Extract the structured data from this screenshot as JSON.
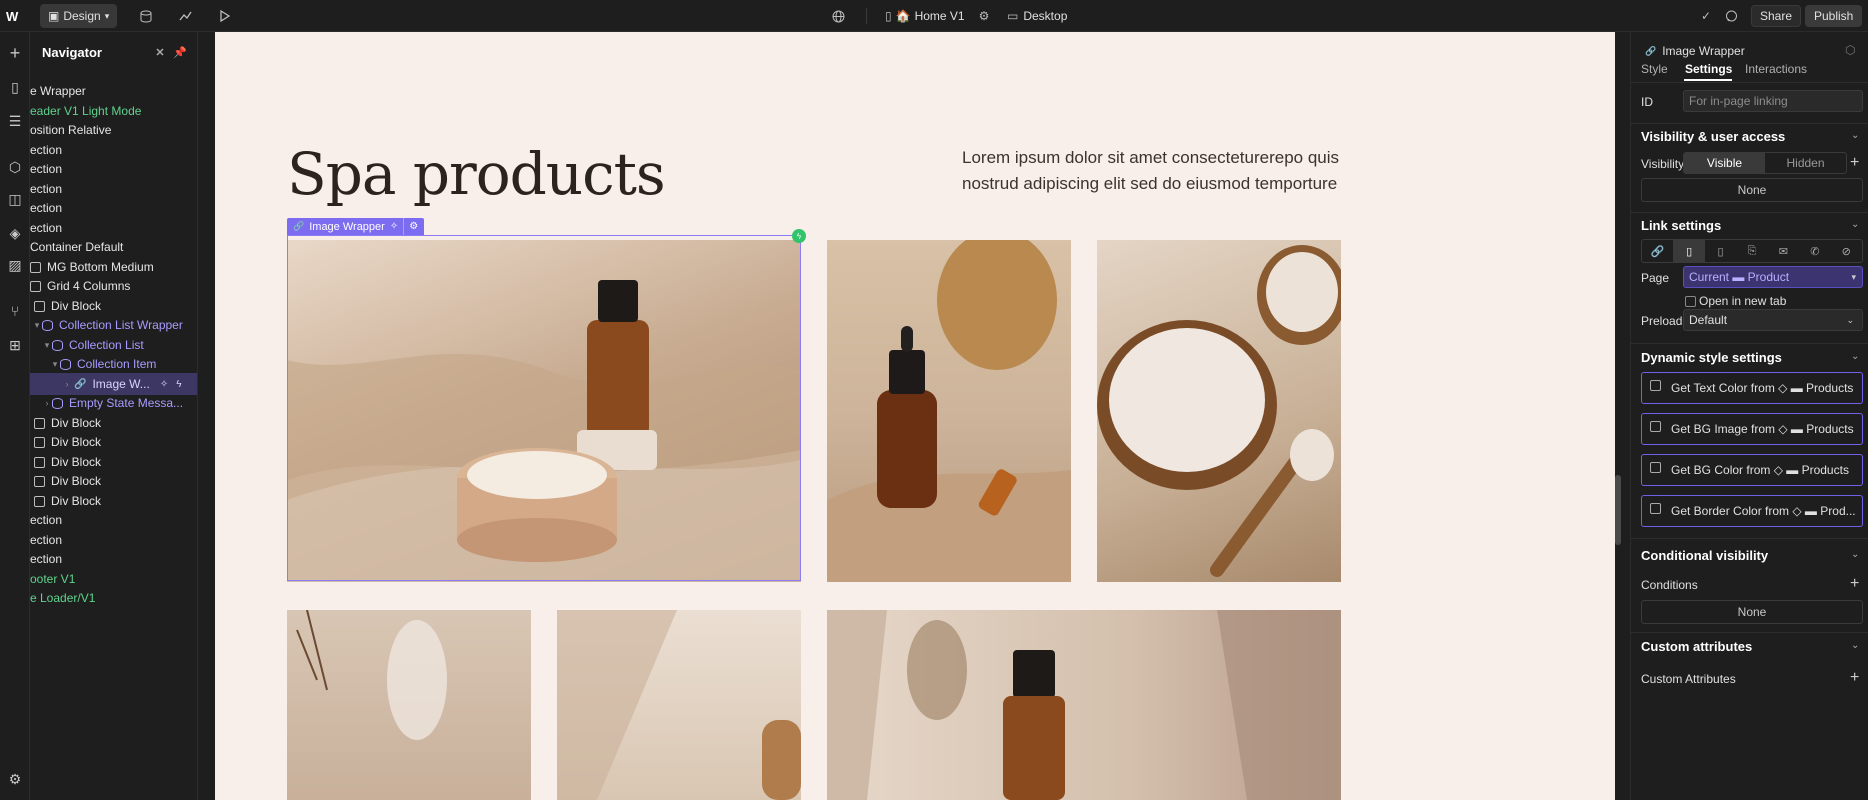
{
  "topbar": {
    "logo": "W",
    "design_label": "Design",
    "page_label": "Home V1",
    "breakpoint_label": "Desktop",
    "share_label": "Share",
    "publish_label": "Publish"
  },
  "navigator": {
    "title": "Navigator",
    "items": [
      {
        "label": "e Wrapper",
        "style": "white"
      },
      {
        "label": "eader V1 Light Mode",
        "style": "green"
      },
      {
        "label": "osition Relative",
        "style": "white"
      },
      {
        "label": "ection",
        "style": "white"
      },
      {
        "label": "ection",
        "style": "white"
      },
      {
        "label": "ection",
        "style": "white"
      },
      {
        "label": "ection",
        "style": "white"
      },
      {
        "label": "ection",
        "style": "white"
      },
      {
        "label": "Container Default",
        "style": "white"
      },
      {
        "label": "MG Bottom Medium",
        "style": "white"
      },
      {
        "label": "Grid 4 Columns",
        "style": "white"
      },
      {
        "label": "Div Block",
        "style": "white"
      },
      {
        "label": "Collection List Wrapper",
        "style": "purple"
      },
      {
        "label": "Collection List",
        "style": "purple"
      },
      {
        "label": "Collection Item",
        "style": "purple"
      },
      {
        "label": "Image W...",
        "style": "selected"
      },
      {
        "label": "Empty State Messa...",
        "style": "purple"
      },
      {
        "label": "Div Block",
        "style": "white"
      },
      {
        "label": "Div Block",
        "style": "white"
      },
      {
        "label": "Div Block",
        "style": "white"
      },
      {
        "label": "Div Block",
        "style": "white"
      },
      {
        "label": "Div Block",
        "style": "white"
      },
      {
        "label": "ection",
        "style": "white"
      },
      {
        "label": "ection",
        "style": "white"
      },
      {
        "label": "ection",
        "style": "white"
      },
      {
        "label": "ooter V1",
        "style": "green"
      },
      {
        "label": "e Loader/V1",
        "style": "green"
      }
    ]
  },
  "canvas": {
    "heading": "Spa products",
    "lead": "Lorem ipsum dolor sit amet consecteturerepo quis nostrud adipiscing elit sed do eiusmod temporture",
    "selection_label": "Image Wrapper"
  },
  "panel": {
    "element_name": "Image Wrapper",
    "tabs": [
      "Style",
      "Settings",
      "Interactions"
    ],
    "id_label": "ID",
    "id_placeholder": "For in-page linking",
    "visibility_section": "Visibility & user access",
    "visibility_label": "Visibility",
    "visible_label": "Visible",
    "hidden_label": "Hidden",
    "none_label": "None",
    "link_section": "Link settings",
    "page_label": "Page",
    "page_value": "Current ▬ Product",
    "new_tab_label": "Open in new tab",
    "preload_label": "Preload",
    "preload_value": "Default",
    "dynamic_section": "Dynamic style settings",
    "dynamic_items": [
      "Get Text Color from ◇ ▬ Products",
      "Get BG Image from ◇ ▬ Products",
      "Get BG Color from ◇ ▬ Products",
      "Get Border Color from ◇ ▬ Prod..."
    ],
    "conditional_section": "Conditional visibility",
    "conditions_label": "Conditions",
    "conditions_none": "None",
    "custom_attr_section": "Custom attributes",
    "custom_attr_label": "Custom Attributes"
  },
  "colors": {
    "accent": "#7c6cf0",
    "page_bg": "#f8eeea",
    "green": "#5fd38d"
  }
}
